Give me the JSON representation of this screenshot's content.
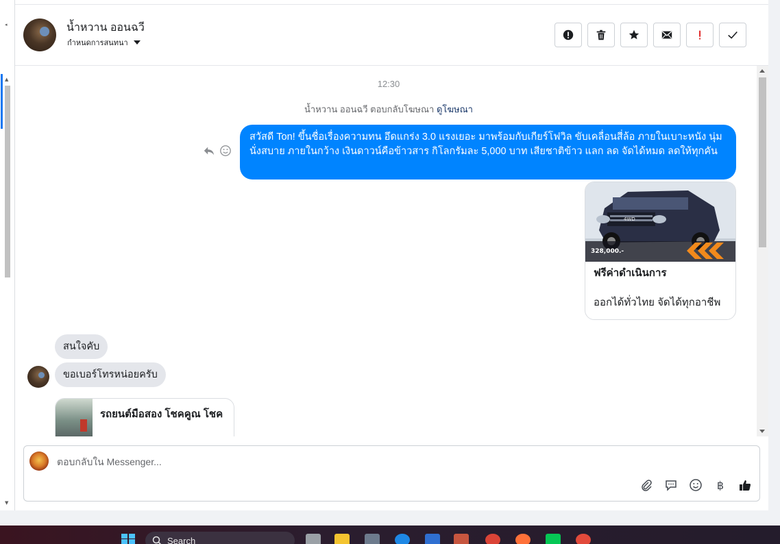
{
  "header": {
    "contact_name": "น้ำหวาน ออนฉวี",
    "subtitle": "กำหนดการสนทนา",
    "actions": [
      {
        "name": "report-icon"
      },
      {
        "name": "trash-icon"
      },
      {
        "name": "star-icon"
      },
      {
        "name": "mail-icon"
      },
      {
        "name": "important-icon"
      },
      {
        "name": "check-icon"
      }
    ]
  },
  "chat": {
    "timestamp": "12:30",
    "ad_reply_notice": "น้ำหวาน ออนฉวี ตอบกลับโฆษณา",
    "ad_reply_link": "ดูโฆษณา",
    "outgoing_message": "สวัสดี Ton! ขึ้นชื่อเรื่องความทน อึดแกร่ง 3.0 แรงเยอะ มาพร้อมกับเกียร์โฟวิล ขับเคลื่อนสี่ล้อ ภายในเบาะหนัง นุ่มนั่งสบาย ภายในกว้าง เงินดาวน์คือข้าวสาร กิโลกรัมละ 5,000 บาท เสียชาติข้าว แลก ลด จัดได้หมด ลดให้ทุกคัน",
    "ad_card": {
      "title": "ฟรีค่าดำเนินการ",
      "description": "ออกได้ทั่วไทย จัดได้ทุกอาชีพ",
      "image_badge": "4WD",
      "image_price": "328,000.-"
    },
    "incoming_messages": [
      "สนใจคับ",
      "ขอเบอร์โทรหน่อยครับ"
    ],
    "link_card": {
      "title": "รถยนต์มือสอง โชคคูณ โชค"
    }
  },
  "composer": {
    "placeholder": "ตอบกลับใน Messenger...",
    "tools": [
      "paperclip-icon",
      "speech-bubble-icon",
      "smiley-icon",
      "baht-icon",
      "thumbs-up-icon"
    ],
    "baht_symbol": "฿"
  },
  "taskbar": {
    "search_label": "Search"
  },
  "colors": {
    "outgoing_bubble": "#0084ff",
    "incoming_bubble": "#e4e6eb",
    "link_color": "#1c3a6b"
  }
}
